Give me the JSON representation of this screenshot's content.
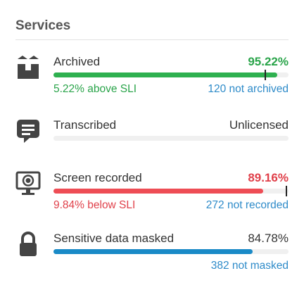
{
  "panel": {
    "title": "Services"
  },
  "services": [
    {
      "label": "Archived",
      "value": "95.22%",
      "value_status": "good",
      "progress_percent": 95.22,
      "sli_target_percent": 90,
      "bar_color": "#2eb04f",
      "sub_left": "5.22% above SLI",
      "sub_right": "120 not archived",
      "icon": "archive-box-icon"
    },
    {
      "label": "Transcribed",
      "value": "Unlicensed",
      "value_status": "neutral",
      "progress_percent": 0,
      "icon": "transcript-bubble-icon"
    },
    {
      "label": "Screen recorded",
      "value": "89.16%",
      "value_status": "bad",
      "progress_percent": 89.16,
      "sli_target_percent": 99,
      "bar_color": "#ee4d55",
      "sub_left": "9.84% below SLI",
      "sub_right": "272 not recorded",
      "icon": "screen-record-icon"
    },
    {
      "label": "Sensitive data masked",
      "value": "84.78%",
      "value_status": "neutral",
      "progress_percent": 84.78,
      "bar_color": "#1a8ac7",
      "sub_right": "382 not masked",
      "icon": "lock-icon"
    }
  ]
}
